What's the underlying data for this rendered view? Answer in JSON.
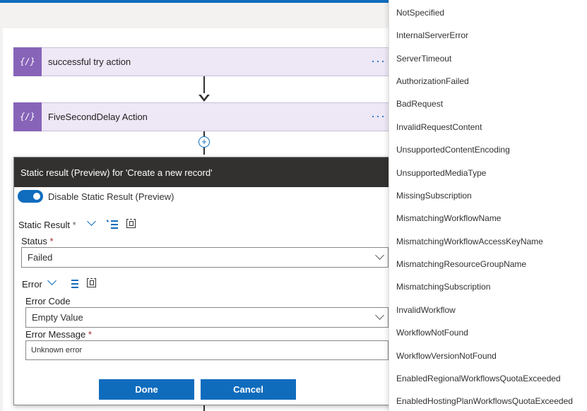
{
  "flow": {
    "actions": [
      {
        "title": "successful try action",
        "more": "···"
      },
      {
        "title": "FiveSecondDelay Action",
        "more": "···"
      }
    ],
    "add_step": "+"
  },
  "panel": {
    "title": "Static result (Preview) for 'Create a new record'",
    "toggle_label": "Disable Static Result (Preview)",
    "static_result_label": "Static Result",
    "status_label": "Status",
    "status_value": "Failed",
    "error_label": "Error",
    "error_code_label": "Error Code",
    "error_code_value": "Empty Value",
    "error_message_label": "Error Message",
    "error_message_value": "Unknown error",
    "required_mark": "*",
    "done_label": "Done",
    "cancel_label": "Cancel"
  },
  "dropdown": {
    "options": [
      "NotSpecified",
      "InternalServerError",
      "ServerTimeout",
      "AuthorizationFailed",
      "BadRequest",
      "InvalidRequestContent",
      "UnsupportedContentEncoding",
      "UnsupportedMediaType",
      "MissingSubscription",
      "MismatchingWorkflowName",
      "MismatchingWorkflowAccessKeyName",
      "MismatchingResourceGroupName",
      "MismatchingSubscription",
      "InvalidWorkflow",
      "WorkflowNotFound",
      "WorkflowVersionNotFound",
      "EnabledRegionalWorkflowsQuotaExceeded",
      "EnabledHostingPlanWorkflowsQuotaExceeded"
    ]
  },
  "colors": {
    "accent": "#0f6cbd",
    "action_icon": "#8764b8",
    "header_bg": "#323130"
  }
}
